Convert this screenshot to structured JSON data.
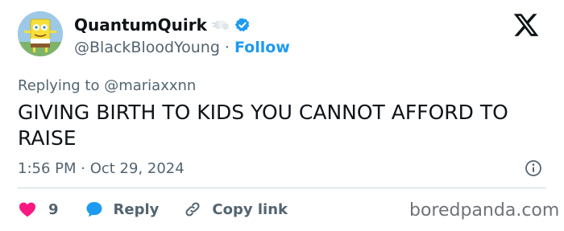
{
  "author": {
    "display_name": "QuantumQuirk",
    "name_emoji": "dash-emoji",
    "verified": true,
    "handle": "@BlackBloodYoung",
    "separator": "·",
    "follow_label": "Follow"
  },
  "reply_context": {
    "prefix": "Replying to",
    "mention": "@mariaxxnn"
  },
  "tweet": {
    "text": "GIVING BIRTH TO KIDS YOU CANNOT AFFORD TO RAISE",
    "timestamp": "1:56 PM · Oct 29, 2024"
  },
  "actions": {
    "like_count": "9",
    "reply_label": "Reply",
    "copy_link_label": "Copy link"
  },
  "watermark": "boredpanda.com",
  "colors": {
    "accent": "#1d9bf0",
    "like": "#f91880",
    "text": "#0f1419",
    "muted": "#536471"
  },
  "icons": [
    "avatar-image",
    "dash-emoji-icon",
    "verified-badge-icon",
    "x-logo-icon",
    "info-icon",
    "heart-icon",
    "reply-bubble-icon",
    "link-icon"
  ]
}
